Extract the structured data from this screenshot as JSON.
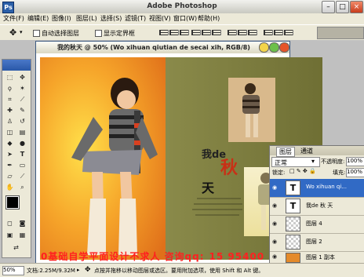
{
  "window": {
    "title": "Adobe Photoshop"
  },
  "menu": [
    "文件(F)",
    "编辑(E)",
    "图像(I)",
    "图层(L)",
    "选择(S)",
    "滤镜(T)",
    "视图(V)",
    "窗口(W)",
    "帮助(H)"
  ],
  "options": {
    "auto_select": "自动选择图层",
    "show_bbox": "显示定界框"
  },
  "document": {
    "title": "我的秋天 @ 50% (Wo xihuan qiutian de secai xih, RGB/8)",
    "art_wo_de": "我de",
    "art_qiu": "秋",
    "art_tian": "天"
  },
  "layers": {
    "tabs": [
      "图层",
      "通道"
    ],
    "blend_mode": "正常",
    "opacity_label": "不透明度:",
    "opacity_value": "100%",
    "lock_label": "锁定:",
    "fill_label": "填充:",
    "fill_value": "100%",
    "items": [
      {
        "name": "Wo xihuan qi...",
        "type": "text",
        "selected": true
      },
      {
        "name": "我de  秋 天",
        "type": "text",
        "selected": false
      },
      {
        "name": "图层 4",
        "type": "pixel",
        "selected": false
      },
      {
        "name": "图层 2",
        "type": "pixel",
        "selected": false
      },
      {
        "name": "图层 1 副本",
        "type": "pixel",
        "selected": false
      }
    ]
  },
  "status": {
    "zoom": "50%",
    "doc_size": "文档:2.25M/9.32M",
    "hint": "点按并拖移以移动图层或选区。要用附加选项，使用 Shift 和 Alt 键。"
  },
  "watermark": "0基础自学平面设计不求人 咨询qq:",
  "watermark_partial": "15 95400",
  "colors": {
    "accent": "#316ac5",
    "orange": "#f08a1e",
    "olive": "#7d7d3a"
  }
}
